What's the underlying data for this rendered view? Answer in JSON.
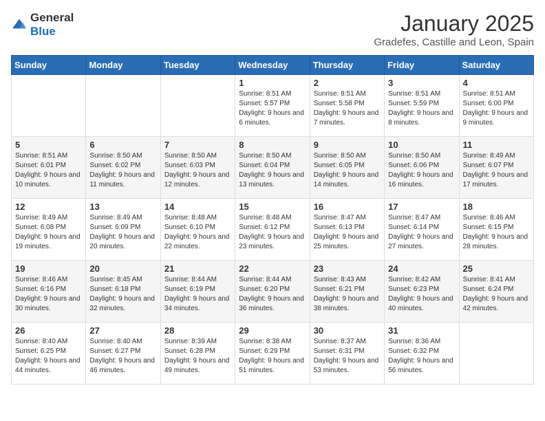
{
  "header": {
    "logo_general": "General",
    "logo_blue": "Blue",
    "month": "January 2025",
    "location": "Gradefes, Castille and Leon, Spain"
  },
  "weekdays": [
    "Sunday",
    "Monday",
    "Tuesday",
    "Wednesday",
    "Thursday",
    "Friday",
    "Saturday"
  ],
  "weeks": [
    [
      {
        "day": "",
        "info": ""
      },
      {
        "day": "",
        "info": ""
      },
      {
        "day": "",
        "info": ""
      },
      {
        "day": "1",
        "info": "Sunrise: 8:51 AM\nSunset: 5:57 PM\nDaylight: 9 hours and 6 minutes."
      },
      {
        "day": "2",
        "info": "Sunrise: 8:51 AM\nSunset: 5:58 PM\nDaylight: 9 hours and 7 minutes."
      },
      {
        "day": "3",
        "info": "Sunrise: 8:51 AM\nSunset: 5:59 PM\nDaylight: 9 hours and 8 minutes."
      },
      {
        "day": "4",
        "info": "Sunrise: 8:51 AM\nSunset: 6:00 PM\nDaylight: 9 hours and 9 minutes."
      }
    ],
    [
      {
        "day": "5",
        "info": "Sunrise: 8:51 AM\nSunset: 6:01 PM\nDaylight: 9 hours and 10 minutes."
      },
      {
        "day": "6",
        "info": "Sunrise: 8:50 AM\nSunset: 6:02 PM\nDaylight: 9 hours and 11 minutes."
      },
      {
        "day": "7",
        "info": "Sunrise: 8:50 AM\nSunset: 6:03 PM\nDaylight: 9 hours and 12 minutes."
      },
      {
        "day": "8",
        "info": "Sunrise: 8:50 AM\nSunset: 6:04 PM\nDaylight: 9 hours and 13 minutes."
      },
      {
        "day": "9",
        "info": "Sunrise: 8:50 AM\nSunset: 6:05 PM\nDaylight: 9 hours and 14 minutes."
      },
      {
        "day": "10",
        "info": "Sunrise: 8:50 AM\nSunset: 6:06 PM\nDaylight: 9 hours and 16 minutes."
      },
      {
        "day": "11",
        "info": "Sunrise: 8:49 AM\nSunset: 6:07 PM\nDaylight: 9 hours and 17 minutes."
      }
    ],
    [
      {
        "day": "12",
        "info": "Sunrise: 8:49 AM\nSunset: 6:08 PM\nDaylight: 9 hours and 19 minutes."
      },
      {
        "day": "13",
        "info": "Sunrise: 8:49 AM\nSunset: 6:09 PM\nDaylight: 9 hours and 20 minutes."
      },
      {
        "day": "14",
        "info": "Sunrise: 8:48 AM\nSunset: 6:10 PM\nDaylight: 9 hours and 22 minutes."
      },
      {
        "day": "15",
        "info": "Sunrise: 8:48 AM\nSunset: 6:12 PM\nDaylight: 9 hours and 23 minutes."
      },
      {
        "day": "16",
        "info": "Sunrise: 8:47 AM\nSunset: 6:13 PM\nDaylight: 9 hours and 25 minutes."
      },
      {
        "day": "17",
        "info": "Sunrise: 8:47 AM\nSunset: 6:14 PM\nDaylight: 9 hours and 27 minutes."
      },
      {
        "day": "18",
        "info": "Sunrise: 8:46 AM\nSunset: 6:15 PM\nDaylight: 9 hours and 28 minutes."
      }
    ],
    [
      {
        "day": "19",
        "info": "Sunrise: 8:46 AM\nSunset: 6:16 PM\nDaylight: 9 hours and 30 minutes."
      },
      {
        "day": "20",
        "info": "Sunrise: 8:45 AM\nSunset: 6:18 PM\nDaylight: 9 hours and 32 minutes."
      },
      {
        "day": "21",
        "info": "Sunrise: 8:44 AM\nSunset: 6:19 PM\nDaylight: 9 hours and 34 minutes."
      },
      {
        "day": "22",
        "info": "Sunrise: 8:44 AM\nSunset: 6:20 PM\nDaylight: 9 hours and 36 minutes."
      },
      {
        "day": "23",
        "info": "Sunrise: 8:43 AM\nSunset: 6:21 PM\nDaylight: 9 hours and 38 minutes."
      },
      {
        "day": "24",
        "info": "Sunrise: 8:42 AM\nSunset: 6:23 PM\nDaylight: 9 hours and 40 minutes."
      },
      {
        "day": "25",
        "info": "Sunrise: 8:41 AM\nSunset: 6:24 PM\nDaylight: 9 hours and 42 minutes."
      }
    ],
    [
      {
        "day": "26",
        "info": "Sunrise: 8:40 AM\nSunset: 6:25 PM\nDaylight: 9 hours and 44 minutes."
      },
      {
        "day": "27",
        "info": "Sunrise: 8:40 AM\nSunset: 6:27 PM\nDaylight: 9 hours and 46 minutes."
      },
      {
        "day": "28",
        "info": "Sunrise: 8:39 AM\nSunset: 6:28 PM\nDaylight: 9 hours and 49 minutes."
      },
      {
        "day": "29",
        "info": "Sunrise: 8:38 AM\nSunset: 6:29 PM\nDaylight: 9 hours and 51 minutes."
      },
      {
        "day": "30",
        "info": "Sunrise: 8:37 AM\nSunset: 6:31 PM\nDaylight: 9 hours and 53 minutes."
      },
      {
        "day": "31",
        "info": "Sunrise: 8:36 AM\nSunset: 6:32 PM\nDaylight: 9 hours and 56 minutes."
      },
      {
        "day": "",
        "info": ""
      }
    ]
  ]
}
